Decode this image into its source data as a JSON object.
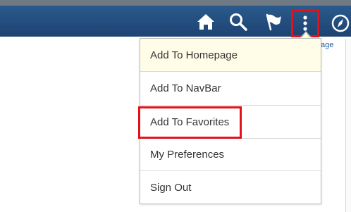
{
  "header": {
    "icons": {
      "home": "home-icon",
      "search": "search-icon",
      "notifications": "flag-icon",
      "actions": "vertical-ellipsis-icon",
      "navbar": "compass-icon"
    },
    "partial_link_text": "age"
  },
  "actions_menu": {
    "items": [
      {
        "label": "Add To Homepage"
      },
      {
        "label": "Add To NavBar"
      },
      {
        "label": "Add To Favorites"
      },
      {
        "label": "My Preferences"
      },
      {
        "label": "Sign Out"
      }
    ]
  },
  "colors": {
    "banner": "#1d4372",
    "highlight_outline": "#e0121c",
    "menu_hover": "#fffde8",
    "link": "#1d5b9e"
  }
}
